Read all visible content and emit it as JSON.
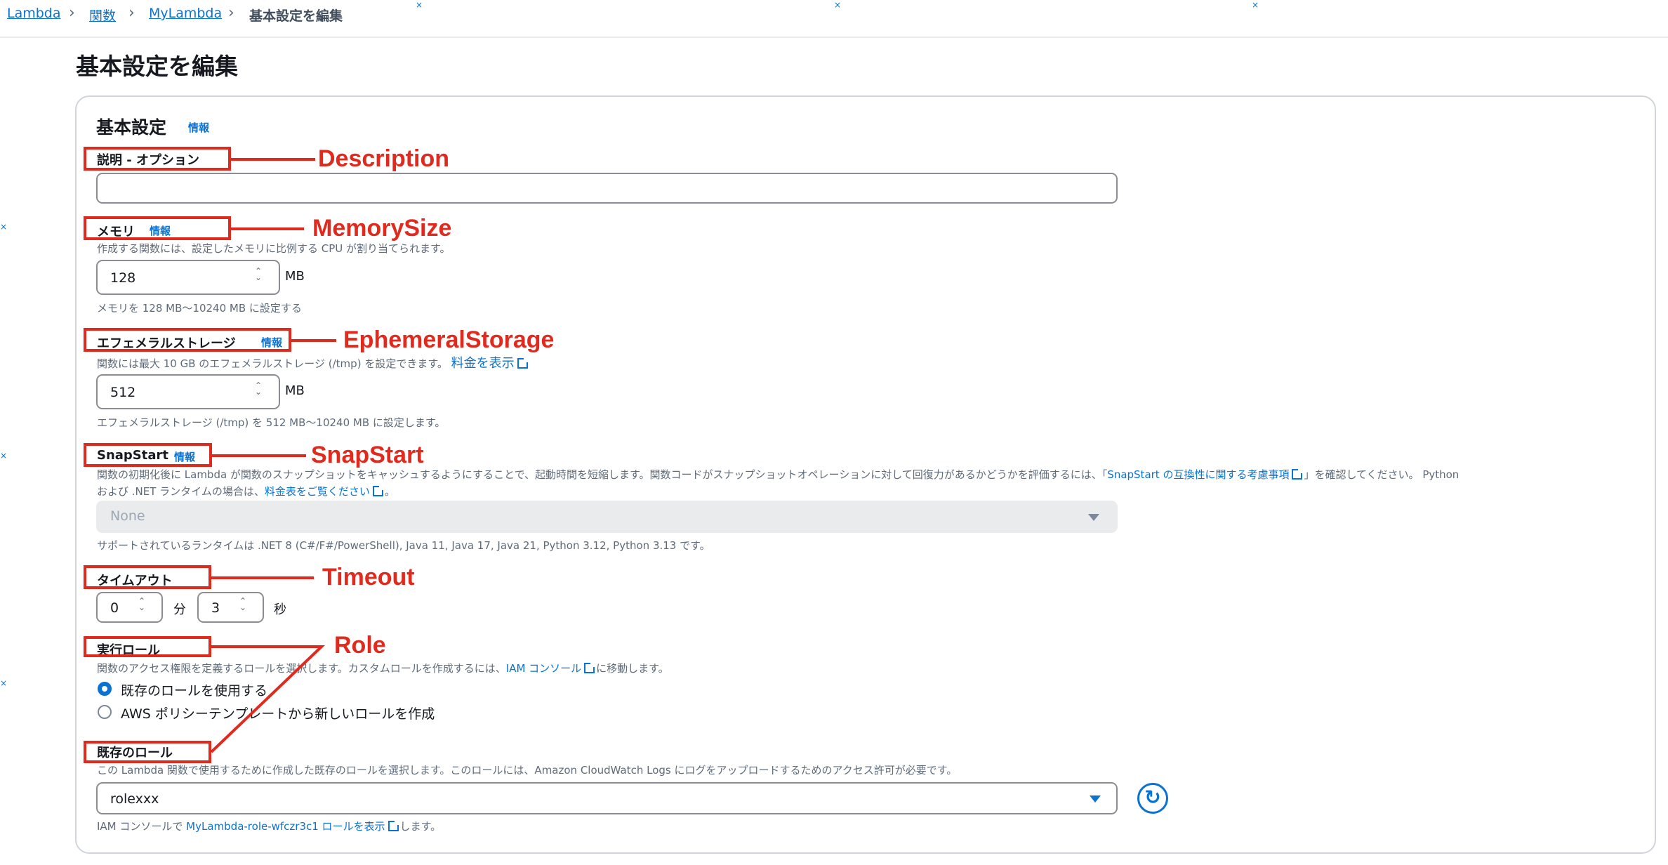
{
  "breadcrumb": {
    "items": [
      "Lambda",
      "関数",
      "MyLambda"
    ],
    "current": "基本設定を編集"
  },
  "page_title": "基本設定を編集",
  "section": {
    "title": "基本設定",
    "info": "情報"
  },
  "description": {
    "label": "説明 - オプション",
    "value": ""
  },
  "memory": {
    "label": "メモリ",
    "info": "情報",
    "help": "作成する関数には、設定したメモリに比例する CPU が割り当てられます。",
    "value": "128",
    "unit": "MB",
    "constraint": "メモリを 128 MB〜10240 MB に設定する"
  },
  "ephemeral": {
    "label": "エフェメラルストレージ",
    "info": "情報",
    "help": "関数には最大 10 GB のエフェメラルストレージ (/tmp) を設定できます。",
    "help_link": "料金を表示",
    "value": "512",
    "unit": "MB",
    "constraint": "エフェメラルストレージ (/tmp) を 512 MB〜10240 MB に設定します。"
  },
  "snapstart": {
    "label": "SnapStart",
    "info": "情報",
    "help1": "関数の初期化後に Lambda が関数のスナップショットをキャッシュするようにすることで、起動時間を短縮します。関数コードがスナップショットオペレーションに対して回復力があるかどうかを評価するには、「",
    "help1_link": "SnapStart の互換性に関する考慮事項",
    "help1_end": "」を確認してください。 Python",
    "help2": "および .NET ランタイムの場合は、",
    "help2_link": "料金表をご覧ください",
    "help2_end": "。",
    "selected": "None",
    "constraint": "サポートされているランタイムは .NET 8 (C#/F#/PowerShell), Java 11, Java 17, Java 21, Python 3.12, Python 3.13 です。"
  },
  "timeout": {
    "label": "タイムアウト",
    "minutes": "0",
    "minutes_unit": "分",
    "seconds": "3",
    "seconds_unit": "秒"
  },
  "role": {
    "label": "実行ロール",
    "help": "関数のアクセス権限を定義するロールを選択します。カスタムロールを作成するには、",
    "help_link": "IAM コンソール",
    "help_end": "に移動します。",
    "options": [
      "既存のロールを使用する",
      "AWS ポリシーテンプレートから新しいロールを作成"
    ],
    "selected_index": 0
  },
  "existing_role": {
    "label": "既存のロール",
    "help": "この Lambda 関数で使用するために作成した既存のロールを選択します。このロールには、Amazon CloudWatch Logs にログをアップロードするためのアクセス許可が必要です。",
    "selected": "rolexxx",
    "footer_prefix": "IAM コンソールで ",
    "footer_link": "MyLambda-role-wfczr3c1 ロールを表示",
    "footer_suffix": "します。"
  },
  "annotations": {
    "description": "Description",
    "memory": "MemorySize",
    "ephemeral": "EphemeralStorage",
    "snapstart": "SnapStart",
    "timeout": "Timeout",
    "role": "Role"
  },
  "colors": {
    "link": "#0972d3",
    "annotation": "#e02a1e",
    "border": "#8c8c94"
  },
  "icons": {
    "breadcrumb_separator": "chevron-right-icon",
    "external": "external-link-icon",
    "refresh": "refresh-icon",
    "dropdown": "caret-down-icon"
  }
}
